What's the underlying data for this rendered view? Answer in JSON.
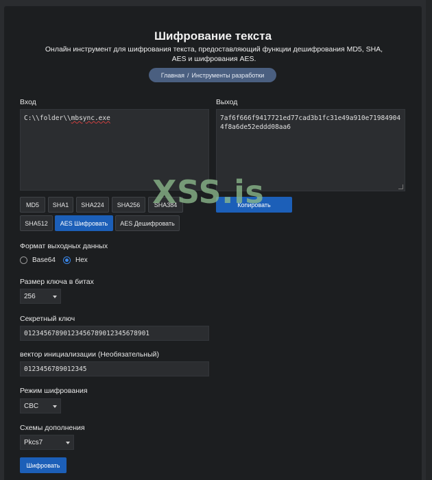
{
  "header": {
    "title": "Шифрование текста",
    "description": "Онлайн инструмент для шифрования текста, предоставляющий функции дешифрования MD5, SHA, AES и шифрования AES.",
    "breadcrumb": {
      "home": "Главная",
      "separator": "/",
      "current": "Инструменты разработки"
    }
  },
  "input": {
    "label": "Вход",
    "prefix": "C:\\\\folder\\\\",
    "suffix": "mbsync.exe"
  },
  "output": {
    "label": "Выход",
    "value": "7af6f666f9417721ed77cad3b1fc31e49a910e719849044f8a6de52eddd08aa6"
  },
  "buttons": {
    "md5": "MD5",
    "sha1": "SHA1",
    "sha224": "SHA224",
    "sha256": "SHA256",
    "sha384": "SHA384",
    "sha512": "SHA512",
    "aes_encrypt": "AES Шифровать",
    "aes_decrypt": "AES Дешифровать",
    "copy": "Копировать",
    "encrypt": "Шифровать"
  },
  "output_format": {
    "label": "Формат выходных данных",
    "options": [
      "Base64",
      "Hex"
    ],
    "selected": "Hex"
  },
  "key_size": {
    "label": "Размер ключа в битах",
    "value": "256"
  },
  "secret_key": {
    "label": "Секретный ключ",
    "value": "01234567890123456789012345678901"
  },
  "iv": {
    "label": "вектор инициализации (Необязательный)",
    "value": "0123456789012345"
  },
  "mode": {
    "label": "Режим шифрования",
    "value": "CBC"
  },
  "padding": {
    "label": "Схемы дополнения",
    "value": "Pkcs7"
  },
  "watermark": "XSS.is",
  "colors": {
    "accent": "#1c5fb8",
    "panel": "#1c1e20",
    "field": "#2b2d30",
    "breadcrumb_bg": "#4a5f80"
  }
}
